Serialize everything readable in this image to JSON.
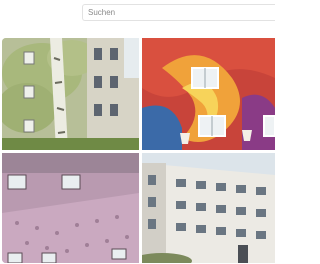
{
  "search": {
    "placeholder": "Suchen"
  },
  "gallery": {
    "tiles": [
      {
        "icon": "photo-building-with-tree-mural"
      },
      {
        "icon": "photo-building-with-colorful-mural"
      },
      {
        "icon": "photo-building-with-pink-patterned-facade"
      },
      {
        "icon": "photo-white-apartment-building"
      }
    ]
  },
  "colors": {
    "background": "#ffffff",
    "search_border": "#e2e2e2",
    "placeholder": "#8a8a8a"
  }
}
